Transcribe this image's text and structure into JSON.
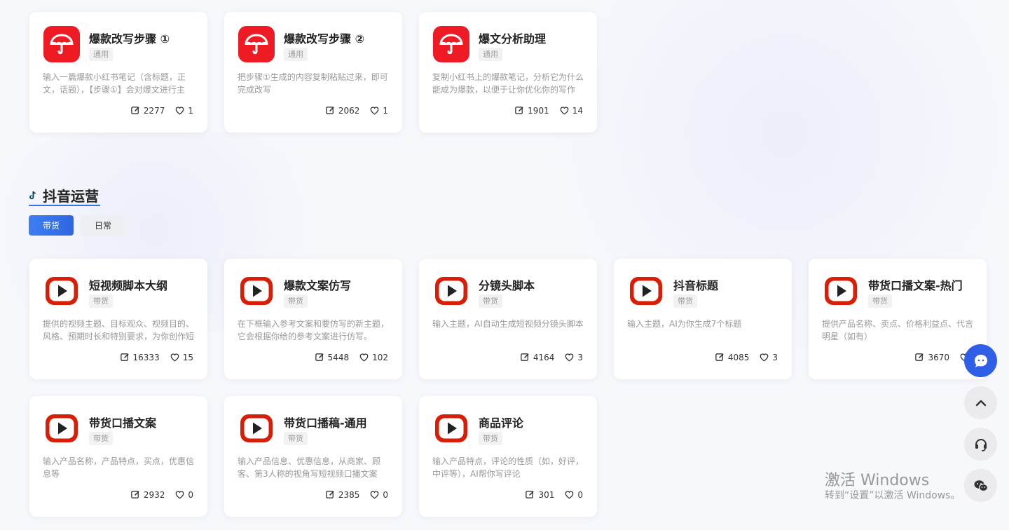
{
  "top_cards": [
    {
      "title": "爆款改写步骤 ①",
      "tag": "通用",
      "desc": "输入一篇爆款小红书笔记（含标题，正文，话题），【步骤①】会对爆文进行主",
      "uses": "2277",
      "likes": "1"
    },
    {
      "title": "爆款改写步骤 ②",
      "tag": "通用",
      "desc": "把步骤①生成的内容复制粘贴过来，即可完成改写",
      "uses": "2062",
      "likes": "1"
    },
    {
      "title": "爆文分析助理",
      "tag": "通用",
      "desc": "复制小红书上的爆款笔记，分析它为什么能成为爆款，以便于让你优化你的写作",
      "uses": "1901",
      "likes": "14"
    }
  ],
  "section": {
    "title": "抖音运营",
    "filters": {
      "active": "带货",
      "inactive": "日常"
    }
  },
  "douyin_cards": [
    {
      "title": "短视频脚本大纲",
      "tag": "带货",
      "desc": "提供的视频主题、目标观众、视频目的、风格、预期时长和特别要求，为你创作短",
      "uses": "16333",
      "likes": "15"
    },
    {
      "title": "爆款文案仿写",
      "tag": "带货",
      "desc": "在下框输入参考文案和要仿写的新主题，它会根据你给的参考文案进行仿写。",
      "uses": "5448",
      "likes": "102"
    },
    {
      "title": "分镜头脚本",
      "tag": "带货",
      "desc": "输入主题，AI自动生成短视频分镜头脚本",
      "uses": "4164",
      "likes": "3"
    },
    {
      "title": "抖音标题",
      "tag": "带货",
      "desc": "输入主题，AI为你生成7个标题",
      "uses": "4085",
      "likes": "3"
    },
    {
      "title": "带货口播文案-热门",
      "tag": "带货",
      "desc": "提供产品名称、卖点、价格利益点、代言明星（如有）",
      "uses": "3670",
      "likes": ""
    },
    {
      "title": "带货口播文案",
      "tag": "带货",
      "desc": "输入产品名称，产品特点，买点，优惠信息等",
      "uses": "2932",
      "likes": "0"
    },
    {
      "title": "带货口播稿-通用",
      "tag": "带货",
      "desc": "输入产品信息、优惠信息，从商家、顾客、第3人称的视角写短视频口播文案",
      "uses": "2385",
      "likes": "0"
    },
    {
      "title": "商品评论",
      "tag": "带货",
      "desc": "输入产品特点，评论的性质（如，好评，中评等），AI帮你写评论",
      "uses": "301",
      "likes": "0"
    }
  ],
  "watermark": {
    "line1": "激活 Windows",
    "line2": "转到“设置”以激活 Windows。"
  },
  "icons": {
    "umbrella": "umbrella-icon",
    "play": "play-icon",
    "edit": "edit-icon",
    "heart": "heart-icon",
    "tiktok": "tiktok-icon",
    "chat": "chat-bot-icon",
    "up": "chevron-up-icon",
    "headset": "headset-icon",
    "wechat": "wechat-icon"
  },
  "colors": {
    "umbrella_bg": "#ee1b24",
    "play_red": "#d81e06",
    "accent_blue": "#2f66e0"
  }
}
